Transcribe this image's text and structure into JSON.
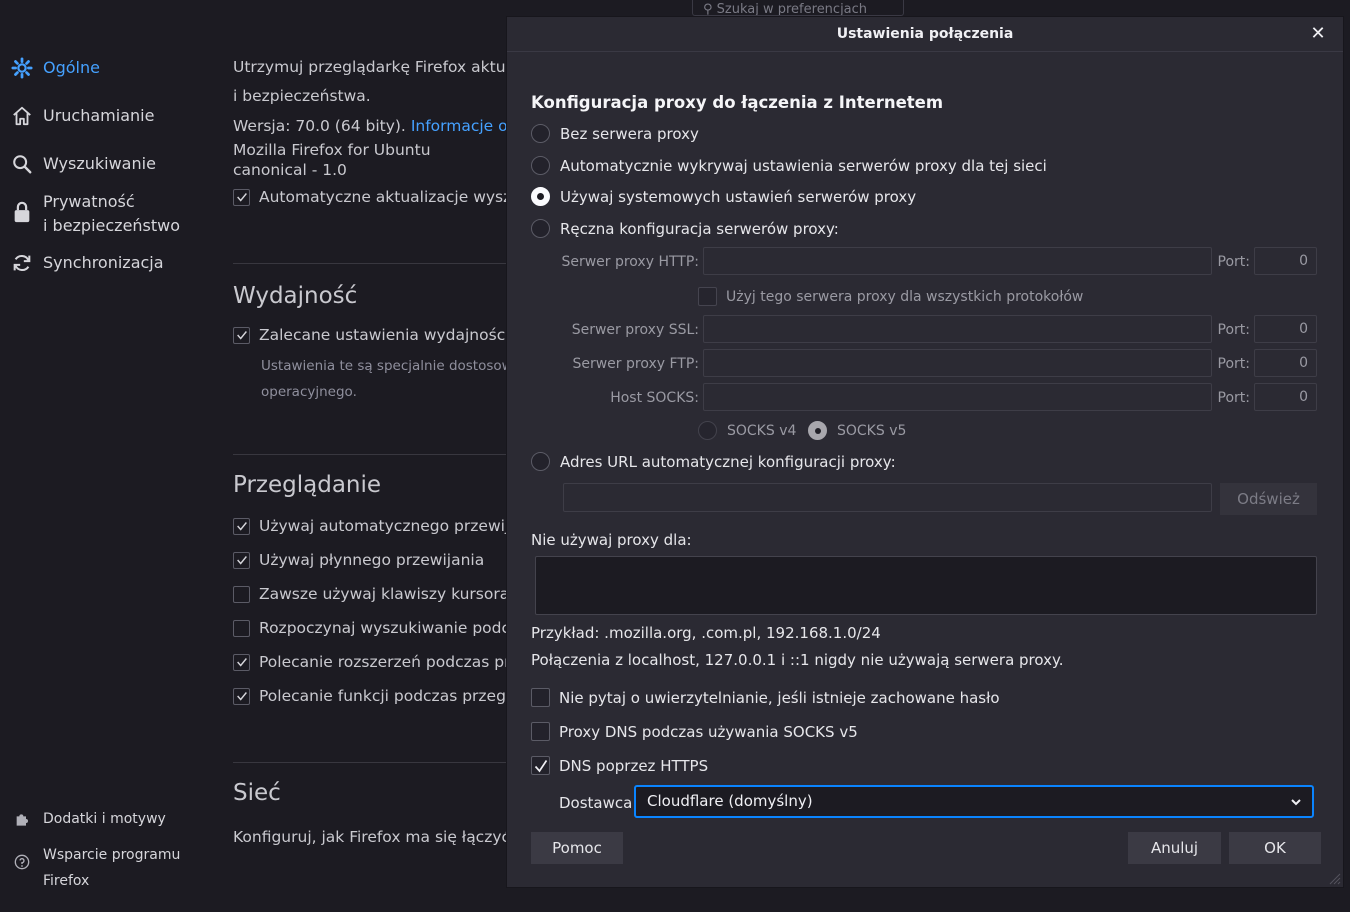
{
  "search": {
    "placeholder": "Szukaj w preferencjach"
  },
  "sidebar": {
    "items": [
      {
        "label": "Ogólne",
        "icon": "gear-icon"
      },
      {
        "label": "Uruchamianie",
        "icon": "home-icon"
      },
      {
        "label": "Wyszukiwanie",
        "icon": "search-icon"
      },
      {
        "label_line1": "Prywatność",
        "label_line2": "i bezpieczeństwo",
        "icon": "lock-icon"
      },
      {
        "label": "Synchronizacja",
        "icon": "sync-icon"
      }
    ],
    "footer": [
      {
        "label": "Dodatki i motywy",
        "icon": "puzzle-icon"
      },
      {
        "label_line1": "Wsparcie programu",
        "label_line2": "Firefox",
        "icon": "help-icon"
      }
    ]
  },
  "general": {
    "update_line1": "Utrzymuj przeglądarkę Firefox aktua",
    "update_line2": "i bezpieczeństwa.",
    "version": "Wersja: 70.0 (64 bity).",
    "version_link": "Informacje o w",
    "build_line1": "Mozilla Firefox for Ubuntu",
    "build_line2": "canonical - 1.0",
    "auto_updates": "Automatyczne aktualizacje wyszu"
  },
  "performance": {
    "heading": "Wydajność",
    "recommended": "Zalecane ustawienia wydajności.",
    "desc_line1": "Ustawienia te są specjalnie dostosow",
    "desc_line2": "operacyjnego."
  },
  "browsing": {
    "heading": "Przeglądanie",
    "options": [
      {
        "label": "Używaj automatycznego przewija",
        "checked": true
      },
      {
        "label": "Używaj płynnego przewijania",
        "checked": true
      },
      {
        "label": "Zawsze używaj klawiszy kursora d",
        "checked": false
      },
      {
        "label": "Rozpoczynaj wyszukiwanie podcz",
        "checked": false
      },
      {
        "label": "Polecanie rozszerzeń podczas prz",
        "checked": true
      },
      {
        "label": "Polecanie funkcji podczas przegl",
        "checked": true
      }
    ]
  },
  "network": {
    "heading": "Sieć",
    "desc": "Konfiguruj, jak Firefox ma się łączyć z"
  },
  "dialog": {
    "title": "Ustawienia połączenia",
    "close_glyph": "✕",
    "section_title": "Konfiguracja proxy do łączenia z Internetem",
    "radios": [
      {
        "label": "Bez serwera proxy",
        "checked": false
      },
      {
        "label": "Automatycznie wykrywaj ustawienia serwerów proxy dla tej sieci",
        "checked": false
      },
      {
        "label": "Używaj systemowych ustawień serwerów proxy",
        "checked": true
      },
      {
        "label": "Ręczna konfiguracja serwerów proxy:",
        "checked": false
      }
    ],
    "http_label": "Serwer proxy HTTP:",
    "port_label": "Port:",
    "http_port": "0",
    "use_for_all": "Użyj tego serwera proxy dla wszystkich protokołów",
    "ssl_label": "Serwer proxy SSL:",
    "ssl_port": "0",
    "ftp_label": "Serwer proxy FTP:",
    "ftp_port": "0",
    "socks_label": "Host SOCKS:",
    "socks_port": "0",
    "socks_v4": "SOCKS v4",
    "socks_v5": "SOCKS v5",
    "autoconfig_label": "Adres URL automatycznej konfiguracji proxy:",
    "refresh_button": "Odśwież",
    "no_proxy_label": "Nie używaj proxy dla:",
    "no_proxy_value": "",
    "example": "Przykład: .mozilla.org, .com.pl, 192.168.1.0/24",
    "localhost_note": "Połączenia z localhost, 127.0.0.1 i ::1 nigdy nie używają serwera proxy.",
    "checkboxes": [
      {
        "label": "Nie pytaj o uwierzytelnianie, jeśli istnieje zachowane hasło",
        "checked": false
      },
      {
        "label": "Proxy DNS podczas używania SOCKS v5",
        "checked": false
      },
      {
        "label": "DNS poprzez HTTPS",
        "checked": true
      }
    ],
    "provider_label": "Dostawca",
    "provider_value": "Cloudflare (domyślny)",
    "help_button": "Pomoc",
    "cancel_button": "Anuluj",
    "ok_button": "OK"
  },
  "colors": {
    "accent": "#45a1ff",
    "focus": "#0a84ff",
    "background": "#1c1b22",
    "dialog": "#2b2a33"
  }
}
